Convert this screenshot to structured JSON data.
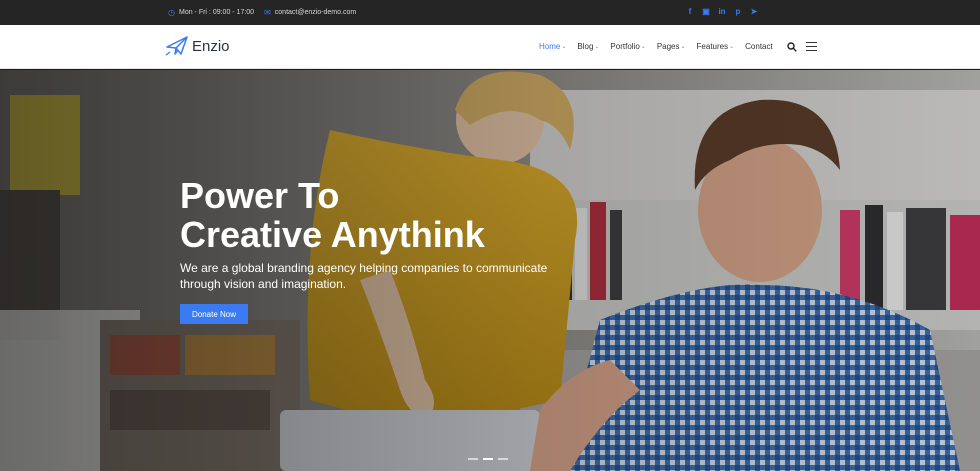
{
  "topbar": {
    "hours": "Mon - Fri : 09:00 - 17:00",
    "email": "contact@enzio-demo.com",
    "social": [
      "f",
      "in-box",
      "in",
      "p",
      "t"
    ]
  },
  "header": {
    "logo_text": "Enzio",
    "nav": [
      "Home",
      "Blog",
      "Portfolio",
      "Pages",
      "Features",
      "Contact"
    ],
    "active_nav": "Home"
  },
  "hero": {
    "title_line1": "Power To",
    "title_line2": "Creative Anythink",
    "subtitle_line1": "We are a global branding agency helping companies to communicate",
    "subtitle_line2": "through vision and imagination.",
    "button_label": "Donate Now",
    "slides": 3,
    "active_slide": 2
  },
  "colors": {
    "accent": "#3a7bf2",
    "topbar_bg": "#252526",
    "header_bg": "#ffffff"
  }
}
